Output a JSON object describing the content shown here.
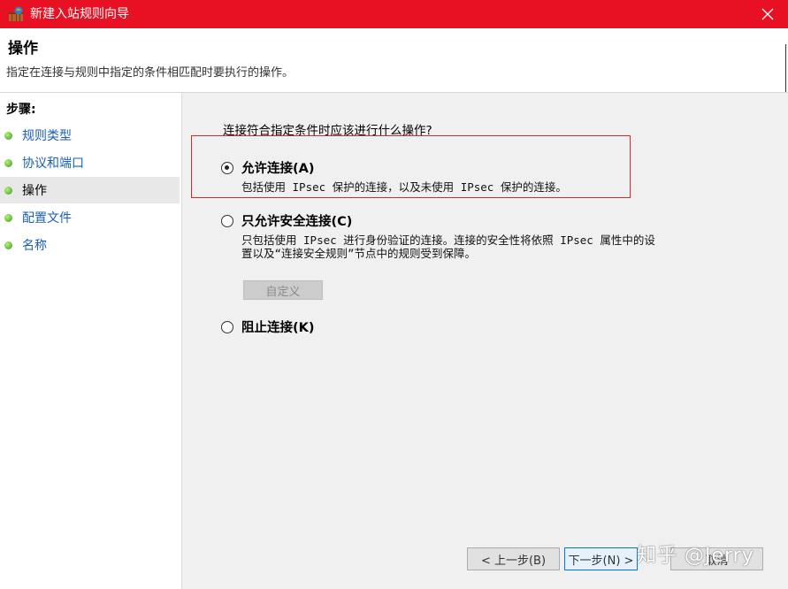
{
  "window": {
    "title": "新建入站规则向导",
    "close_icon": "close-icon",
    "accent": "#e81123"
  },
  "header": {
    "title": "操作",
    "description": "指定在连接与规则中指定的条件相匹配时要执行的操作。"
  },
  "steps": {
    "title": "步骤:",
    "items": [
      {
        "label": "规则类型",
        "active": false
      },
      {
        "label": "协议和端口",
        "active": false
      },
      {
        "label": "操作",
        "active": true
      },
      {
        "label": "配置文件",
        "active": false
      },
      {
        "label": "名称",
        "active": false
      }
    ]
  },
  "main": {
    "question": "连接符合指定条件时应该进行什么操作?",
    "options": [
      {
        "label": "允许连接(A)",
        "checked": true,
        "description": [
          "包括使用 IPsec 保护的连接，以及未使用 IPsec 保护的连接。"
        ]
      },
      {
        "label": "只允许安全连接(C)",
        "checked": false,
        "description": [
          "只包括使用 IPsec 进行身份验证的连接。连接的安全性将依照 IPsec 属性中的设",
          "置以及“连接安全规则”节点中的规则受到保障。"
        ]
      },
      {
        "label": "阻止连接(K)",
        "checked": false,
        "description": []
      }
    ],
    "customize_label": "自定义"
  },
  "buttons": {
    "back": "< 上一步(B)",
    "next": "下一步(N) >",
    "cancel": "取消"
  },
  "watermark": "知乎 @Jerry"
}
